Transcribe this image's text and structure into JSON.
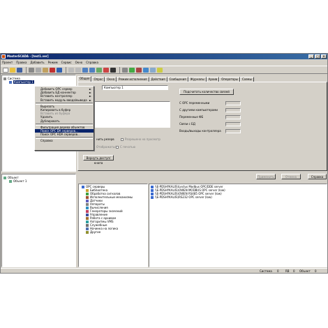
{
  "window": {
    "title": "MasterSCADA - [test1.ver]",
    "controls": [
      "_",
      "□",
      "×"
    ]
  },
  "menu": [
    "Проект",
    "Правка",
    "Добавить",
    "Режим",
    "Сервис",
    "Окно",
    "Справка"
  ],
  "top_tree": {
    "root": "Система",
    "child": "Компьютер 1"
  },
  "context_menu": {
    "items": [
      {
        "label": "Добавить OPC сервер",
        "arrow": "►"
      },
      {
        "label": "Добавить БД коннектор",
        "arrow": "►"
      },
      {
        "label": "Вставить контроллер",
        "arrow": "►"
      },
      {
        "label": "Вставить модуль ввода/вывода",
        "arrow": "►"
      },
      {
        "label": "Вырезать"
      },
      {
        "label": "Копировать в буфер"
      },
      {
        "label": "Вставить из буфера"
      },
      {
        "label": "Удалить"
      },
      {
        "label": "Дублировать"
      },
      {
        "label": "Фильтрация дерева объектов"
      },
      {
        "label": "Поиск OPC DA серверов..."
      },
      {
        "label": "Поиск OPC HDA серверов..."
      },
      {
        "label": "Справка"
      }
    ]
  },
  "tabs": [
    "Общие",
    "Опрос",
    "Окна",
    "Режим исполнения",
    "Действия",
    "Сообщения",
    "Журналы",
    "Архив",
    "Операторы",
    "Схемы"
  ],
  "props": {
    "name_value": "Компьютер 1",
    "count_button": "Подсчитать количество связей",
    "opc_label": "С OPC переменными",
    "other_label": "С другими компьютерами",
    "fb_label": "Переменные ФБ",
    "db_label": "Связи с БД",
    "io_label": "Входы/выходы контроллера",
    "reserve_label": "нить резерв",
    "alloc1": "Разрешено на просмотр",
    "alloc2": "Отображаться",
    "alloc3": "С печатью",
    "access_button": "Вернуть доступ/кнопа",
    "apply_button": "Применить",
    "cancel_button": "Отмена",
    "help_button": "Справка"
  },
  "bottom_tree": {
    "root": "Объект",
    "child": "Объект 1"
  },
  "library": [
    "OPC серверы",
    "Библиотека",
    "Обработка сигналов",
    "Исполнительные механизмы",
    "Датчики",
    "Аппараты",
    "Вычисления",
    "Генераторы значений",
    "Управление",
    "Работа с архивом",
    "Алгоритмы VMS",
    "Служебные",
    "Начинка на логика",
    "Другие"
  ],
  "servers": [
    "\\\\E-PDSHYKALIS\\\\Lectus Modbus OPC/DDE server",
    "\\\\E-PDSHYKALIS\\\\OWEN MODBUS OPC server (low)",
    "\\\\E-PDSHYKALIS\\\\OWEN RS485 OPC server (low)",
    "\\\\E-PDSHYKALIS\\\\RS232 OPC server (low)"
  ],
  "status": {
    "label": "Система",
    "v1": "0",
    "v2": "RB",
    "v3": "0",
    "obj": "Объект",
    "v4": "0"
  },
  "colors": {
    "titlebar": "#0a246a",
    "selection": "#0a246a",
    "face": "#d4d0c8"
  }
}
